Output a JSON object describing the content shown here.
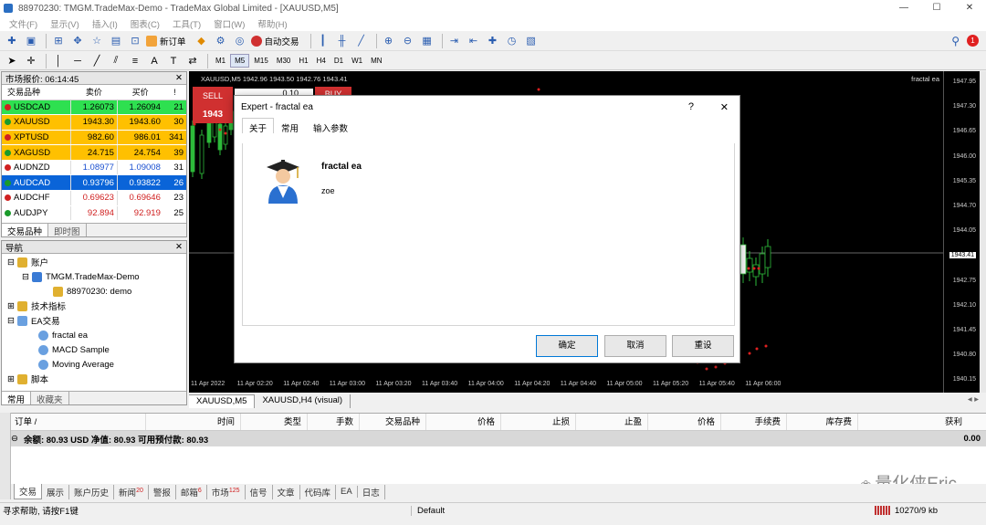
{
  "window": {
    "title": "88970230: TMGM.TradeMax-Demo - TradeMax Global Limited - [XAUUSD,M5]",
    "min": "—",
    "max": "☐",
    "close": "✕"
  },
  "menu": [
    "文件(F)",
    "显示(V)",
    "插入(I)",
    "图表(C)",
    "工具(T)",
    "窗口(W)",
    "帮助(H)"
  ],
  "toolbar": {
    "new_order": "新订单",
    "auto_trade": "自动交易",
    "notif_count": "1"
  },
  "timeframes": [
    "M1",
    "M5",
    "M15",
    "M30",
    "H1",
    "H4",
    "D1",
    "W1",
    "MN"
  ],
  "active_timeframe": "M5",
  "market_watch": {
    "title": "市场报价: 06:14:45",
    "headers": [
      "交易品种",
      "卖价",
      "买价",
      "!"
    ],
    "rows": [
      {
        "sym": "USDCAD",
        "bid": "1.26073",
        "ask": "1.26094",
        "spread": "21",
        "bg": "#2ee050"
      },
      {
        "sym": "XAUUSD",
        "bid": "1943.30",
        "ask": "1943.60",
        "spread": "30",
        "bg": "#ffc000"
      },
      {
        "sym": "XPTUSD",
        "bid": "982.60",
        "ask": "986.01",
        "spread": "341",
        "bg": "#ffc000"
      },
      {
        "sym": "XAGUSD",
        "bid": "24.715",
        "ask": "24.754",
        "spread": "39",
        "bg": "#ffc000"
      },
      {
        "sym": "AUDNZD",
        "bid": "1.08977",
        "ask": "1.09008",
        "spread": "31",
        "bg": "#ffffff"
      },
      {
        "sym": "AUDCAD",
        "bid": "0.93796",
        "ask": "0.93822",
        "spread": "26",
        "bg": "#0a64d8"
      },
      {
        "sym": "AUDCHF",
        "bid": "0.69623",
        "ask": "0.69646",
        "spread": "23",
        "bg": "#ffffff"
      },
      {
        "sym": "AUDJPY",
        "bid": "92.894",
        "ask": "92.919",
        "spread": "25",
        "bg": "#ffffff"
      }
    ],
    "tabs": [
      "交易品种",
      "即时图"
    ]
  },
  "navigator": {
    "title": "导航",
    "items": [
      {
        "label": "账户",
        "level": 0
      },
      {
        "label": "TMGM.TradeMax-Demo",
        "level": 1
      },
      {
        "label": "88970230: demo",
        "level": 2
      },
      {
        "label": "技术指标",
        "level": 0
      },
      {
        "label": "EA交易",
        "level": 0
      },
      {
        "label": "fractal ea",
        "level": 1
      },
      {
        "label": "MACD Sample",
        "level": 1
      },
      {
        "label": "Moving Average",
        "level": 1
      },
      {
        "label": "脚本",
        "level": 0
      }
    ],
    "tabs": [
      "常用",
      "收藏夹"
    ]
  },
  "chart": {
    "header": "XAUUSD,M5  1942.96 1943.50 1942.76 1943.41",
    "ea_label": "fractal ea",
    "sell_label": "SELL",
    "buy_label": "BUY",
    "lot": "0.10",
    "sell_price": "1943",
    "current_price": "1943.41",
    "y_ticks": [
      "1947.95",
      "1947.30",
      "1946.65",
      "1946.00",
      "1945.35",
      "1944.70",
      "1944.05",
      "1943.41",
      "1942.75",
      "1942.10",
      "1941.45",
      "1940.80",
      "1940.15"
    ],
    "x_ticks": [
      "11 Apr 2022",
      "11 Apr 02:20",
      "11 Apr 02:40",
      "11 Apr 03:00",
      "11 Apr 03:20",
      "11 Apr 03:40",
      "11 Apr 04:00",
      "11 Apr 04:20",
      "11 Apr 04:40",
      "11 Apr 05:00",
      "11 Apr 05:20",
      "11 Apr 05:40",
      "11 Apr 06:00"
    ],
    "tabs": [
      "XAUUSD,M5",
      "XAUUSD,H4 (visual)"
    ]
  },
  "dialog": {
    "title": "Expert - fractal ea",
    "help": "?",
    "close": "✕",
    "tabs": [
      "关于",
      "常用",
      "输入参数"
    ],
    "ea_name": "fractal ea",
    "author": "zoe",
    "ok": "确定",
    "cancel": "取消",
    "reset": "重设"
  },
  "terminal": {
    "headers": [
      "订单 /",
      "时间",
      "类型",
      "手数",
      "交易品种",
      "价格",
      "止损",
      "止盈",
      "价格",
      "手续费",
      "库存费",
      "获利"
    ],
    "balance_line": "余额: 80.93 USD  净值: 80.93  可用预付款: 80.93",
    "profit": "0.00",
    "tabs": [
      {
        "label": "交易",
        "badge": ""
      },
      {
        "label": "展示",
        "badge": ""
      },
      {
        "label": "账户历史",
        "badge": ""
      },
      {
        "label": "新闻",
        "badge": "20"
      },
      {
        "label": "警报",
        "badge": ""
      },
      {
        "label": "邮箱",
        "badge": "6"
      },
      {
        "label": "市场",
        "badge": "125"
      },
      {
        "label": "信号",
        "badge": ""
      },
      {
        "label": "文章",
        "badge": ""
      },
      {
        "label": "代码库",
        "badge": ""
      },
      {
        "label": "EA",
        "badge": ""
      },
      {
        "label": "日志",
        "badge": ""
      }
    ]
  },
  "status": {
    "help": "寻求帮助, 请按F1键",
    "profile": "Default",
    "traffic": "10270/9 kb"
  },
  "watermark": "量化侠Eric"
}
